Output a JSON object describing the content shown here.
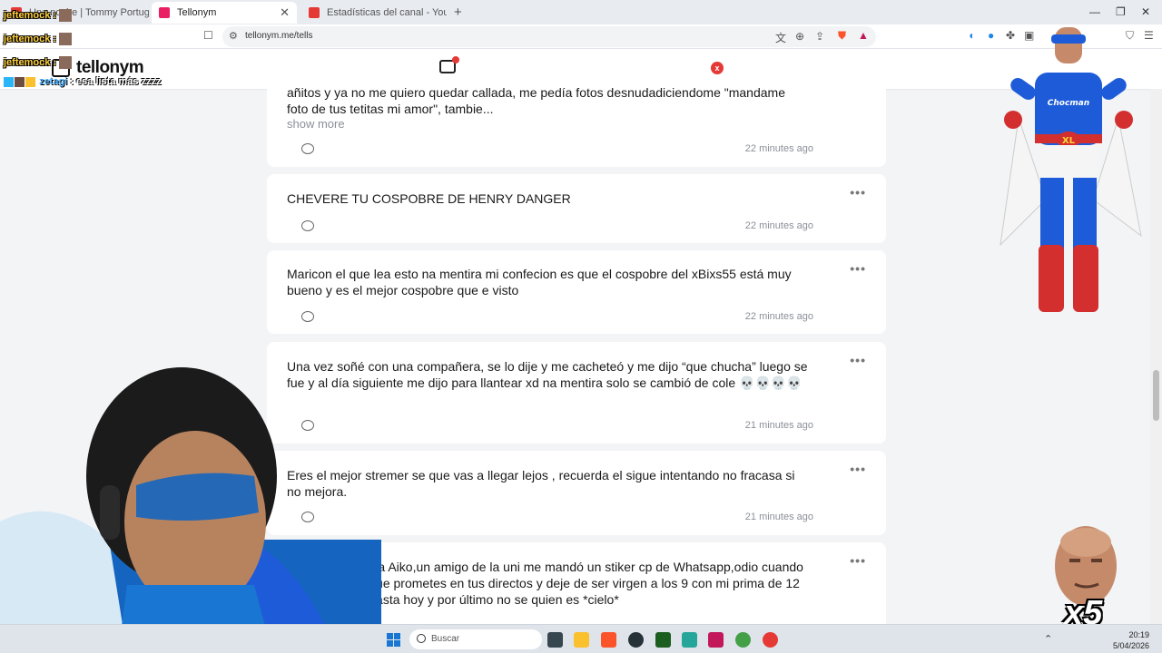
{
  "browser": {
    "tabs": [
      {
        "title": "Una noche | Tommy Portugal (Le",
        "favicon_color": "#e53935",
        "active": false
      },
      {
        "title": "Tellonym",
        "favicon_color": "#e91e63",
        "active": true
      },
      {
        "title": "Estadísticas del canal - YouTube Studi",
        "favicon_color": "#e53935",
        "active": false
      }
    ],
    "url": "tellonym.me/tells"
  },
  "site": {
    "logo": "tellonym",
    "close_badge": "x"
  },
  "chat": {
    "overlay_names": [
      "jeftemock",
      "jeftemock",
      "jeftemock"
    ],
    "last_user": "zetagi",
    "last_message": ": esa lista más zzzz"
  },
  "feed": {
    "cards": [
      {
        "text": "añitos y ya no me quiero quedar callada, me pedía fotos desnudadiciendome \"mandame foto de tus tetitas mi amor\", tambie...",
        "show_more": "show more",
        "time": "22 minutes ago",
        "has_menu": false
      },
      {
        "text": "CHEVERE TU COSPOBRE DE HENRY DANGER",
        "time": "22 minutes ago",
        "has_menu": true
      },
      {
        "text": "Maricon el que lea esto na mentira mi confecion es que el cospobre del xBixs55 está muy bueno y es el mejor cospobre que e visto",
        "time": "22 minutes ago",
        "has_menu": true
      },
      {
        "text": "Una vez soñé con una compañera, se lo dije y me cacheteó y me dijo “que chucha” luego se fue y al día siguiente me dijo para llantear xd na mentira solo se cambió de cole 💀💀💀💀",
        "time": "21 minutes ago",
        "has_menu": true
      },
      {
        "text": "Eres el mejor stremer se que vas a llegar lejos , recuerda el sigue intentando no fracasa si no mejora.",
        "time": "21 minutes ago",
        "has_menu": true
      },
      {
        "text": "Le dedique una a Aiko,un amigo de la uni me mandó un stiker cp de Whatsapp,odio cuando no cumples lo que prometes en tus directos y deje de ser virgen a los 9 con mi prima de 12 me arrepiento hasta hoy y por último no se quien es *cielo*",
        "time": "",
        "has_menu": true
      }
    ]
  },
  "overlays": {
    "hero_emblem": "XL",
    "hero_chest": "Chocman",
    "multiplier": "x5"
  },
  "taskbar": {
    "search_label": "Buscar",
    "time": "20:19",
    "date": "5/04/2026"
  }
}
